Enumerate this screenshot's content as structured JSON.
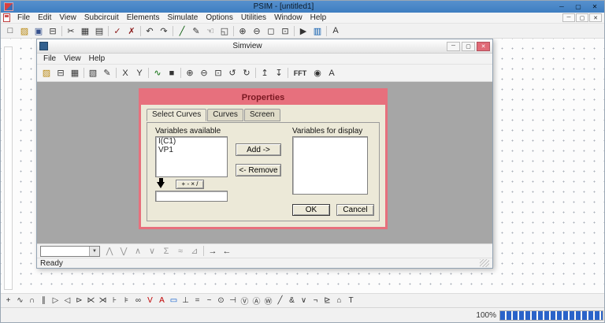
{
  "colors": {
    "titlebar_blue": "#3E7EC1",
    "dialog_pink": "#E7707D",
    "dialog_title_text": "#7A1822",
    "close_red": "#E06A76",
    "progress_blue": "#2A63C9"
  },
  "main_window": {
    "title": "PSIM - [untitled1]",
    "window_buttons": {
      "minimize": "─",
      "maximize": "▢",
      "close": "✕"
    },
    "menu_items": [
      "File",
      "Edit",
      "View",
      "Subcircuit",
      "Elements",
      "Simulate",
      "Options",
      "Utilities",
      "Window",
      "Help"
    ],
    "mdi_buttons": {
      "minimize": "─",
      "restore": "▢",
      "close": "✕"
    },
    "toolbar": [
      {
        "name": "new-icon",
        "glyph": "□"
      },
      {
        "name": "open-icon",
        "glyph": "▨",
        "color": "#B8860B"
      },
      {
        "name": "save-icon",
        "glyph": "▣",
        "color": "#35508C"
      },
      {
        "name": "print-icon",
        "glyph": "⊟"
      },
      {
        "cls": "sep"
      },
      {
        "name": "cut-icon",
        "glyph": "✂"
      },
      {
        "name": "copy-icon",
        "glyph": "▦"
      },
      {
        "name": "paste-icon",
        "glyph": "▤"
      },
      {
        "cls": "sep"
      },
      {
        "name": "run-check-icon",
        "glyph": "✓",
        "color": "#8B1A1A"
      },
      {
        "name": "cancel-cross-icon",
        "glyph": "✗",
        "color": "#8B1A1A"
      },
      {
        "cls": "sep"
      },
      {
        "name": "undo-icon",
        "glyph": "↶"
      },
      {
        "name": "redo-icon",
        "glyph": "↷"
      },
      {
        "cls": "sep"
      },
      {
        "name": "wire-icon",
        "glyph": "╱",
        "color": "#005500"
      },
      {
        "name": "edit-icon",
        "glyph": "✎"
      },
      {
        "name": "pan-icon",
        "glyph": "☜"
      },
      {
        "name": "select-icon",
        "glyph": "◱"
      },
      {
        "cls": "sep"
      },
      {
        "name": "zoom-in-icon",
        "glyph": "⊕"
      },
      {
        "name": "zoom-out-icon",
        "glyph": "⊖"
      },
      {
        "name": "zoom-fit-icon",
        "glyph": "◻"
      },
      {
        "name": "zoom-area-icon",
        "glyph": "⊡"
      },
      {
        "cls": "sep"
      },
      {
        "name": "run-simulation-icon",
        "glyph": "▶"
      },
      {
        "name": "view-waveform-icon",
        "glyph": "▥",
        "color": "#0055AA"
      },
      {
        "cls": "sep"
      },
      {
        "name": "text-icon",
        "glyph": "A"
      }
    ],
    "element_toolbar": [
      {
        "name": "wire-icon",
        "glyph": "+"
      },
      {
        "name": "resistor-icon",
        "glyph": "∿"
      },
      {
        "name": "inductor-icon",
        "glyph": "∩"
      },
      {
        "name": "capacitor-icon",
        "glyph": "∥"
      },
      {
        "name": "diode-icon",
        "glyph": "▷"
      },
      {
        "name": "zener-diode-icon",
        "glyph": "◁"
      },
      {
        "name": "thyristor-icon",
        "glyph": "⊳"
      },
      {
        "name": "npn-transistor-icon",
        "glyph": "⋉"
      },
      {
        "name": "pnp-transistor-icon",
        "glyph": "⋊"
      },
      {
        "name": "mosfet-icon",
        "glyph": "⊦"
      },
      {
        "name": "igbt-icon",
        "glyph": "⊧"
      },
      {
        "name": "transformer-icon",
        "glyph": "∞"
      },
      {
        "name": "voltage-probe-icon",
        "glyph": "V",
        "color": "#C00000"
      },
      {
        "name": "current-probe-icon",
        "glyph": "A",
        "color": "#C00000"
      },
      {
        "name": "scope-icon",
        "glyph": "▭",
        "color": "#0055CC"
      },
      {
        "name": "ground-icon",
        "glyph": "⊥"
      },
      {
        "name": "dc-source-icon",
        "glyph": "="
      },
      {
        "name": "ac-source-icon",
        "glyph": "~"
      },
      {
        "name": "current-source-icon",
        "glyph": "⊙"
      },
      {
        "name": "battery-icon",
        "glyph": "⊣"
      },
      {
        "name": "voltmeter-icon",
        "glyph": "Ⓥ"
      },
      {
        "name": "ammeter-icon",
        "glyph": "Ⓐ"
      },
      {
        "name": "wattmeter-icon",
        "glyph": "Ⓦ"
      },
      {
        "name": "switch-icon",
        "glyph": "╱"
      },
      {
        "name": "and-gate-icon",
        "glyph": "&"
      },
      {
        "name": "or-gate-icon",
        "glyph": "∨"
      },
      {
        "name": "not-gate-icon",
        "glyph": "¬"
      },
      {
        "name": "comparator-icon",
        "glyph": "⊵"
      },
      {
        "name": "label-icon",
        "glyph": "⌂"
      },
      {
        "name": "text-icon",
        "glyph": "T"
      }
    ],
    "status_zoom": "100%"
  },
  "simview": {
    "title": "Simview",
    "window_buttons": {
      "minimize": "─",
      "maximize": "▢",
      "close": "✕"
    },
    "menu_items": [
      "File",
      "View",
      "Help"
    ],
    "toolbar": [
      {
        "name": "open-icon",
        "glyph": "▨",
        "color": "#B8860B"
      },
      {
        "name": "print-icon",
        "glyph": "⊟"
      },
      {
        "name": "copy-icon",
        "glyph": "▦"
      },
      {
        "cls": "sep"
      },
      {
        "name": "properties-icon",
        "glyph": "▧"
      },
      {
        "name": "add-curve-icon",
        "glyph": "✎"
      },
      {
        "cls": "sep"
      },
      {
        "name": "x-axis-button",
        "glyph": "X"
      },
      {
        "name": "y-axis-button",
        "glyph": "Y"
      },
      {
        "cls": "sep"
      },
      {
        "name": "curve-icon",
        "glyph": "∿",
        "color": "#006600"
      },
      {
        "name": "marker-icon",
        "glyph": "■"
      },
      {
        "cls": "sep"
      },
      {
        "name": "zoom-in-icon",
        "glyph": "⊕"
      },
      {
        "name": "zoom-out-icon",
        "glyph": "⊖"
      },
      {
        "name": "zoom-window-icon",
        "glyph": "⊡"
      },
      {
        "name": "undo-zoom-icon",
        "glyph": "↺"
      },
      {
        "name": "redraw-icon",
        "glyph": "↻"
      },
      {
        "cls": "sep"
      },
      {
        "name": "curve-up-icon",
        "glyph": "↥"
      },
      {
        "name": "curve-down-icon",
        "glyph": "↧"
      },
      {
        "cls": "sep"
      },
      {
        "name": "fft-button",
        "glyph": "FFT",
        "cls": "wide"
      },
      {
        "name": "average-icon",
        "glyph": "◉"
      },
      {
        "name": "text-icon",
        "glyph": "A"
      }
    ],
    "bottom_toolbar": {
      "combo_value": "",
      "dropdown_glyph": "▼",
      "icons": [
        {
          "name": "local-max-icon",
          "glyph": "⋀",
          "color": "#9A9A9A"
        },
        {
          "name": "local-min-icon",
          "glyph": "⋁",
          "color": "#9A9A9A"
        },
        {
          "name": "next-max-icon",
          "glyph": "∧",
          "color": "#9A9A9A"
        },
        {
          "name": "next-min-icon",
          "glyph": "∨",
          "color": "#9A9A9A"
        },
        {
          "name": "mean-icon",
          "glyph": "Σ",
          "color": "#9A9A9A"
        },
        {
          "name": "rms-icon",
          "glyph": "≈",
          "color": "#9A9A9A"
        },
        {
          "name": "angle-icon",
          "glyph": "⊿",
          "color": "#9A9A9A"
        },
        {
          "cls": "sep"
        },
        {
          "name": "next-screen-icon",
          "glyph": "→"
        },
        {
          "name": "prev-screen-icon",
          "glyph": "←"
        }
      ]
    },
    "status": "Ready"
  },
  "properties_dialog": {
    "title": "Properties",
    "tabs": [
      {
        "name": "tab-select-curves",
        "label": "Select Curves",
        "cls": "active"
      },
      {
        "name": "tab-curves",
        "label": "Curves"
      },
      {
        "name": "tab-screen",
        "label": "Screen"
      }
    ],
    "available_label": "Variables available",
    "available_items": [
      "I(C1)",
      "VP1"
    ],
    "display_label": "Variables for display",
    "display_items": [],
    "add_button": "Add ->",
    "remove_button": "<- Remove",
    "calc_button": "+ - × /",
    "expression_value": "",
    "ok_button": "OK",
    "cancel_button": "Cancel"
  }
}
